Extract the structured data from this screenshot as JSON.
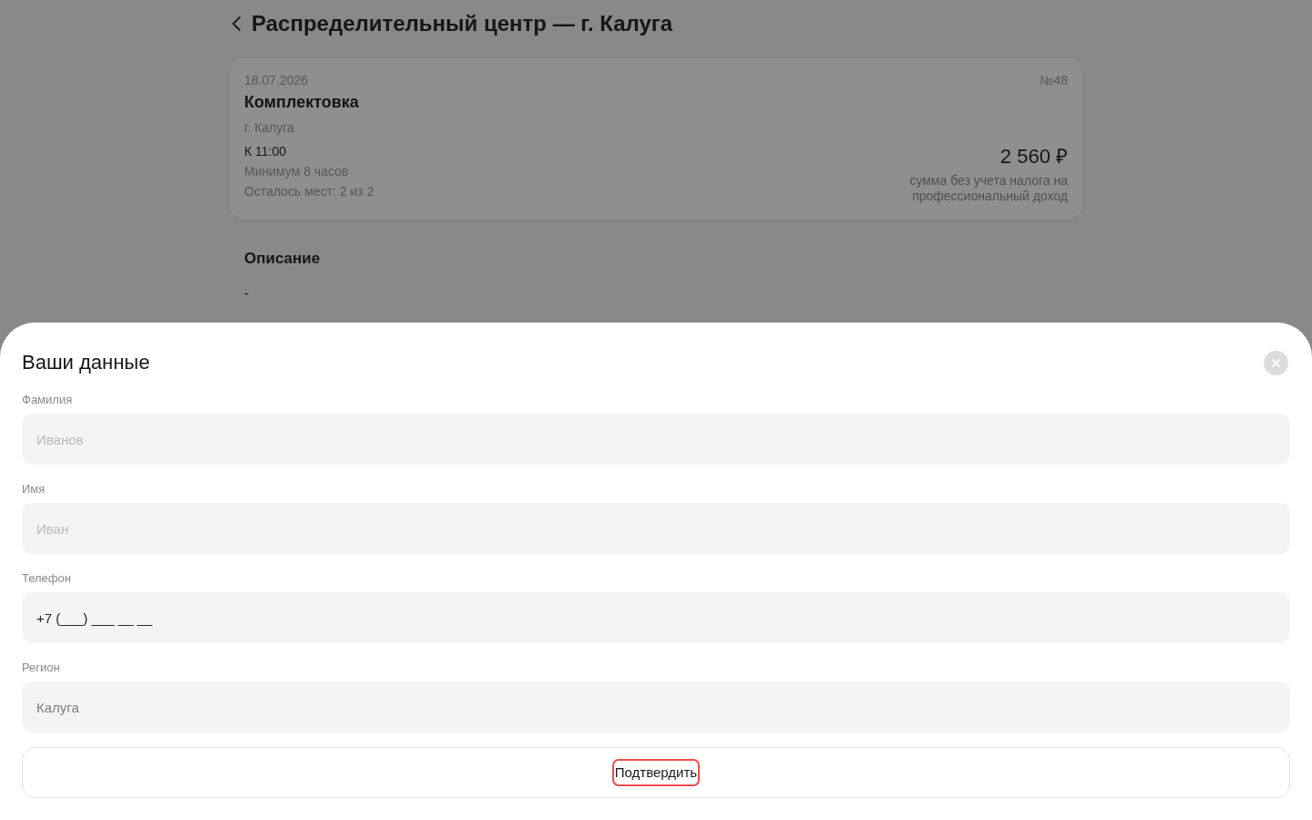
{
  "header": {
    "title": "Распределительный центр — г. Калуга"
  },
  "shift_card": {
    "date": "18.07.2026",
    "number": "№48",
    "title": "Комплектовка",
    "city": "г. Калуга",
    "start_time": "К 11:00",
    "min_duration": "Минимум 8 часов",
    "places_left": "Осталось мест: 2 из 2",
    "price": "2 560 ₽",
    "price_note": "сумма без учета налога на профессиональный доход"
  },
  "description": {
    "heading": "Описание",
    "text": "-"
  },
  "sheet": {
    "title": "Ваши данные",
    "fields": [
      {
        "label": "Фамилия",
        "placeholder": "Иванов",
        "disabled": false
      },
      {
        "label": "Имя",
        "placeholder": "Иван",
        "disabled": false
      },
      {
        "label": "Телефон",
        "value": "+7 (___) ___ __ __",
        "disabled": false
      },
      {
        "label": "Регион",
        "value": "Калуга",
        "disabled": true
      }
    ],
    "submit": {
      "label": "Подтвердить",
      "focused": true
    }
  }
}
